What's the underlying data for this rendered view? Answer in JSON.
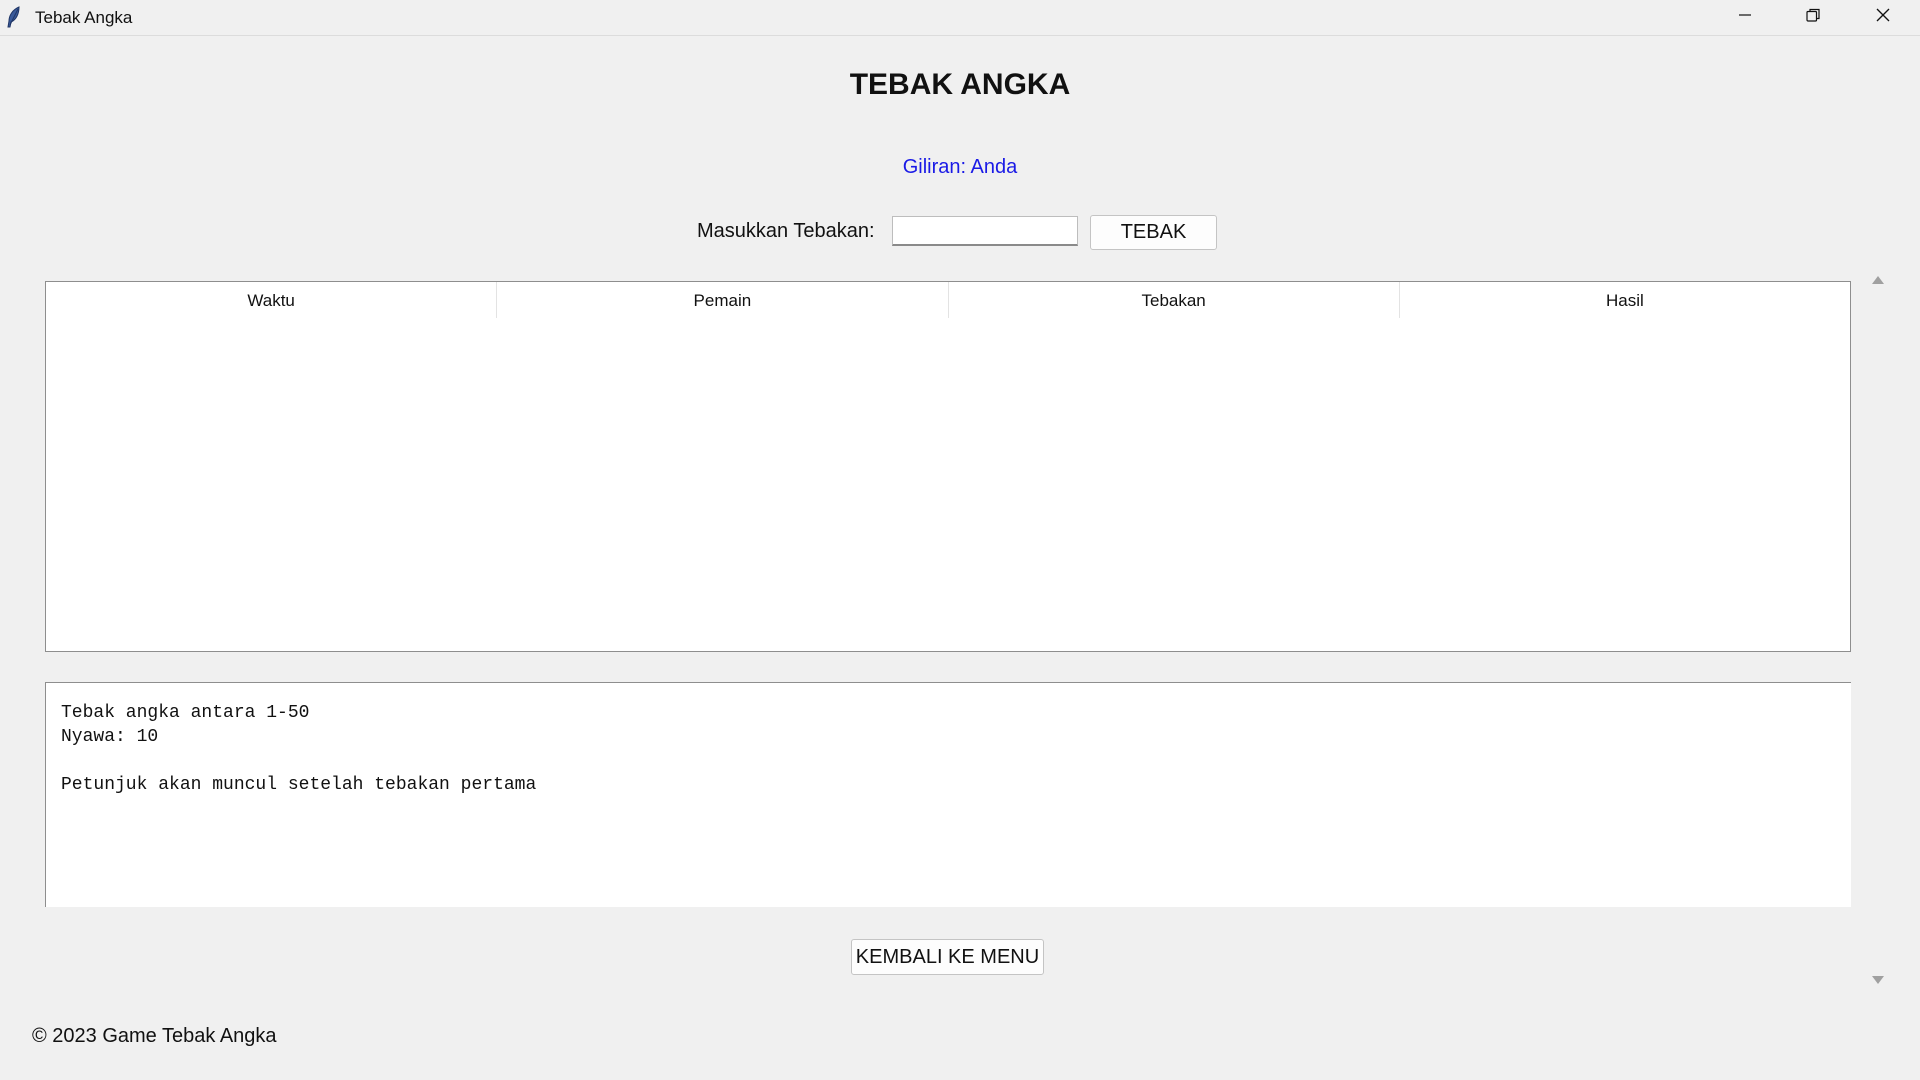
{
  "window": {
    "title": "Tebak Angka"
  },
  "header": {
    "title": "TEBAK ANGKA",
    "turn": "Giliran: Anda",
    "turn_color": "#1a1ae6"
  },
  "guess": {
    "label": "Masukkan Tebakan:",
    "value": "",
    "button_label": "TEBAK"
  },
  "table": {
    "columns": [
      "Waktu",
      "Pemain",
      "Tebakan",
      "Hasil"
    ],
    "rows": []
  },
  "log": {
    "lines": [
      "Tebak angka antara 1-50",
      "Nyawa: 10",
      "",
      "Petunjuk akan muncul setelah tebakan pertama"
    ]
  },
  "footer": {
    "back_button_label": "KEMBALI KE MENU",
    "copyright": "© 2023 Game Tebak Angka"
  },
  "icons": {
    "app": "feather-icon",
    "minimize": "minimize-icon",
    "maximize": "restore-icon",
    "close": "close-icon",
    "scroll_up": "scroll-up-arrow-icon",
    "scroll_down": "scroll-down-arrow-icon"
  }
}
